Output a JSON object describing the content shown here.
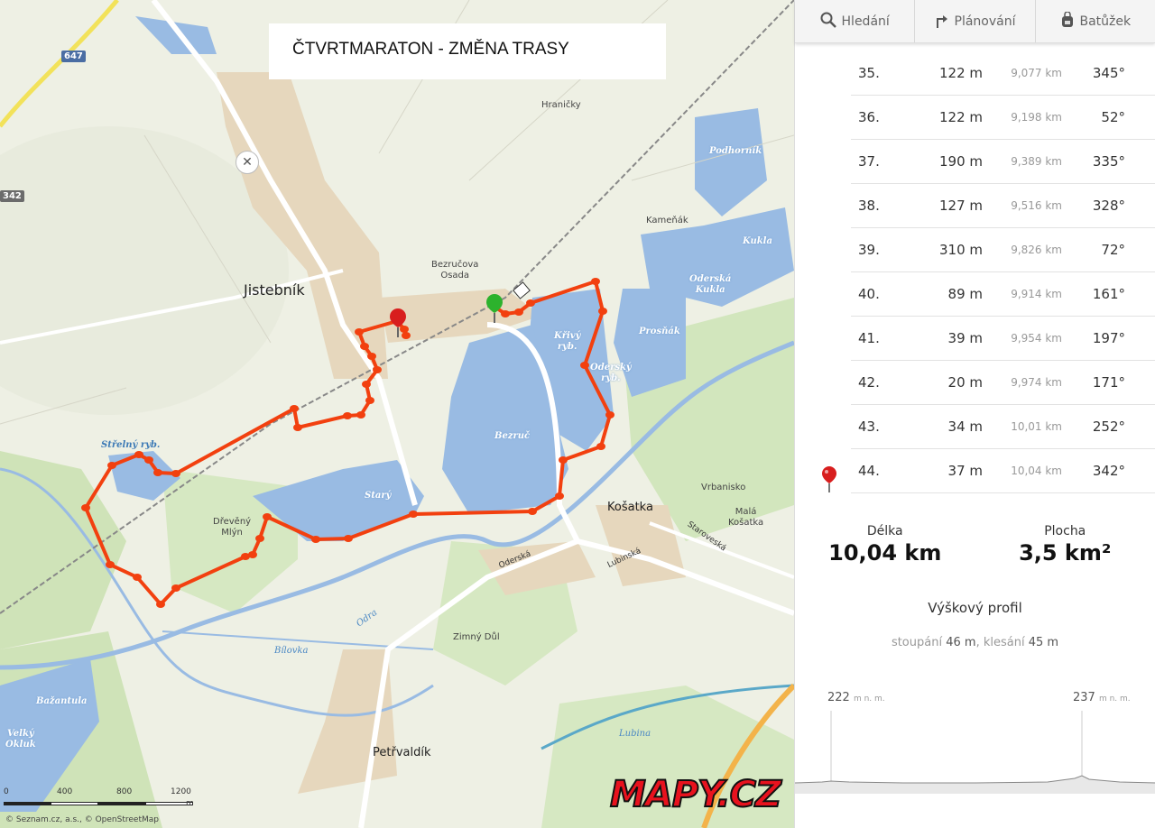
{
  "map": {
    "title": "ČTVRTMARATON - ZMĚNA TRASY",
    "places": {
      "jistebnik": "Jistebník",
      "kosatka": "Košatka",
      "petrvaldik": "Petřvaldík",
      "hranicky": "Hraničky",
      "bezrucova_osada": "Bezručova\nOsada",
      "kamenak": "Kameňák",
      "vrbanisko": "Vrbanisko",
      "mala_kosatka": "Malá\nKošatka",
      "zimny_dul": "Zimný Důl",
      "dreveny_mlyn": "Dřevěný\nMlýn"
    },
    "water": {
      "podhornik": "Podhorník",
      "kukla": "Kukla",
      "odersa_kukla": "Oderská\nKukla",
      "prosnak": "Prosňák",
      "krivy": "Křivý\nryb.",
      "odersky": "Oderský\nryb.",
      "bezruc": "Bezruč",
      "stary": "Starý",
      "strelny": "Střelný ryb.",
      "bazantula": "Bažantula",
      "velky_okluk": "Velký\nOkluk"
    },
    "rivers": {
      "odra": "Odra",
      "bilovka": "Bílovka",
      "lubina": "Lubina"
    },
    "roads": {
      "oderska": "Oderská",
      "lubinska": "Lubinská",
      "staroveska": "Staroveská"
    },
    "road_badges": {
      "r647": "647",
      "r342": "342"
    },
    "scale": {
      "labels": [
        "0",
        "400",
        "800",
        "1200"
      ],
      "unit": "m"
    },
    "attribution": "© Seznam.cz, a.s., © OpenStreetMap",
    "logo": "MAPY.CZ",
    "colors": {
      "route": "#f2400f",
      "water": "#99bbe3",
      "field": "#eef0e4",
      "forest": "#cfe3b8",
      "settlement": "#e6d7bd"
    }
  },
  "sidebar": {
    "tabs": [
      {
        "label": "Hledání",
        "icon": "search-icon"
      },
      {
        "label": "Plánování",
        "icon": "route-icon"
      },
      {
        "label": "Batůžek",
        "icon": "backpack-icon"
      }
    ],
    "rows": [
      {
        "num": "35.",
        "dist": "122 m",
        "cum": "9,077 km",
        "angle": "345°"
      },
      {
        "num": "36.",
        "dist": "122 m",
        "cum": "9,198 km",
        "angle": "52°"
      },
      {
        "num": "37.",
        "dist": "190 m",
        "cum": "9,389 km",
        "angle": "335°"
      },
      {
        "num": "38.",
        "dist": "127 m",
        "cum": "9,516 km",
        "angle": "328°"
      },
      {
        "num": "39.",
        "dist": "310 m",
        "cum": "9,826 km",
        "angle": "72°"
      },
      {
        "num": "40.",
        "dist": "89 m",
        "cum": "9,914 km",
        "angle": "161°"
      },
      {
        "num": "41.",
        "dist": "39 m",
        "cum": "9,954 km",
        "angle": "197°"
      },
      {
        "num": "42.",
        "dist": "20 m",
        "cum": "9,974 km",
        "angle": "171°"
      },
      {
        "num": "43.",
        "dist": "34 m",
        "cum": "10,01 km",
        "angle": "252°"
      },
      {
        "num": "44.",
        "dist": "37 m",
        "cum": "10,04 km",
        "angle": "342°",
        "end_pin": true
      }
    ],
    "stats": {
      "length_label": "Délka",
      "length_value": "10,04 km",
      "area_label": "Plocha",
      "area_value": "3,5 km²"
    },
    "profile": {
      "title": "Výškový profil",
      "ascent_label": "stoupání",
      "ascent_value": "46 m",
      "descent_label": "klesání",
      "descent_value": "45 m",
      "start_alt": "222",
      "end_alt": "237",
      "alt_unit": "m n. m."
    }
  }
}
